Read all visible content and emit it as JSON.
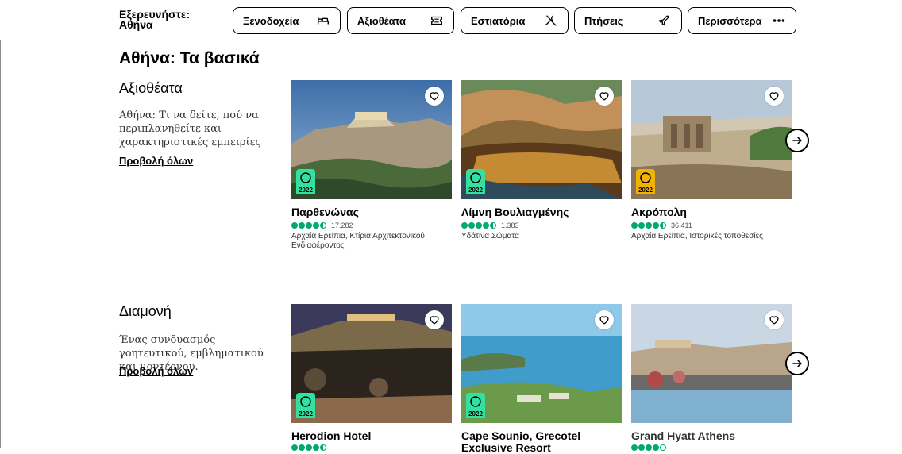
{
  "brand": {
    "line1": "Εξερευνήστε:",
    "line2": "Αθήνα"
  },
  "nav": [
    {
      "label": "Ξενοδοχεία",
      "icon": "bed-icon"
    },
    {
      "label": "Αξιοθέατα",
      "icon": "ticket-icon"
    },
    {
      "label": "Εστιατόρια",
      "icon": "utensils-icon"
    },
    {
      "label": "Πτήσεις",
      "icon": "plane-icon"
    },
    {
      "label": "Περισσότερα",
      "icon": "more-dots-icon"
    }
  ],
  "page_title": "Αθήνα: Τα βασικά",
  "sections": [
    {
      "title": "Αξιοθέατα",
      "description": "Αθήνα: Τι να δείτε, πού να περιπλανηθείτε και χαρακτηριστικές εμπειρίες",
      "link": "Προβολή όλων",
      "cards": [
        {
          "title": "Παρθενώνας",
          "rating": 4.5,
          "reviews": "17.282",
          "subtitle": "Αρχαία Ερείπια, Κτίρια Αρχιτεκτονικού Ενδιαφέροντος",
          "badge": "2022",
          "badge_color": "#34e0a1"
        },
        {
          "title": "Λίμνη Βουλιαγμένης",
          "rating": 4.5,
          "reviews": "1.383",
          "subtitle": "Υδάτινα Σώματα",
          "badge": "2022",
          "badge_color": "#34e0a1"
        },
        {
          "title": "Ακρόπολη",
          "rating": 4.5,
          "reviews": "36.411",
          "subtitle": "Αρχαία Ερείπια, Ιστορικές τοποθεσίες",
          "badge": "2022",
          "badge_color": "#f2b203"
        }
      ]
    },
    {
      "title": "Διαμονή",
      "description": "Ένας συνδυασμός γοητευτικού, εμβληματικού και μοντέρνου.",
      "link": "Προβολή όλων",
      "cards": [
        {
          "title": "Herodion Hotel",
          "badge": "2022",
          "badge_color": "#34e0a1"
        },
        {
          "title": "Cape Sounio, Grecotel",
          "title2": "Exclusive Resort",
          "badge": "2022",
          "badge_color": "#34e0a1"
        },
        {
          "title": "Grand Hyatt Athens"
        }
      ]
    }
  ]
}
